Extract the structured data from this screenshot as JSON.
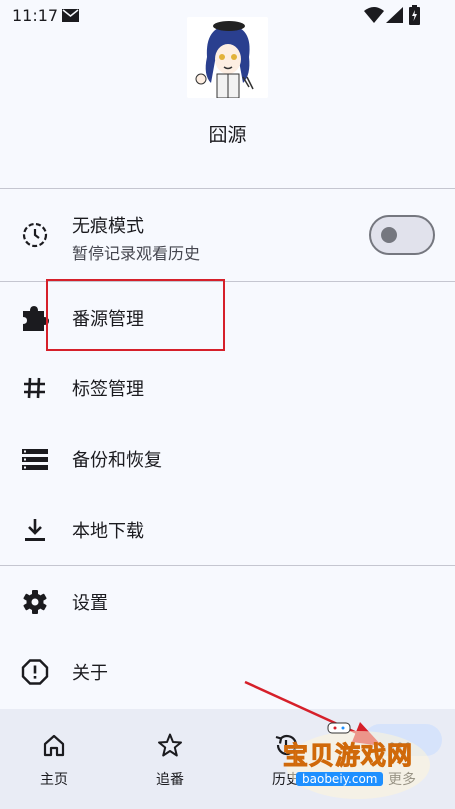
{
  "status_bar": {
    "time": "11:17"
  },
  "header": {
    "title": "囧源"
  },
  "incognito": {
    "title": "无痕模式",
    "subtitle": "暂停记录观看历史",
    "enabled": false
  },
  "menu": {
    "source_manage": "番源管理",
    "tag_manage": "标签管理",
    "backup_restore": "备份和恢复",
    "local_download": "本地下载",
    "settings": "设置",
    "about": "关于"
  },
  "bottom_nav": {
    "items": [
      {
        "label": "主页",
        "icon": "home-icon"
      },
      {
        "label": "追番",
        "icon": "star-icon"
      },
      {
        "label": "历史",
        "icon": "history-icon"
      },
      {
        "label": "更多",
        "icon": "more-icon",
        "selected": true
      }
    ]
  },
  "watermark": {
    "text": "宝贝游戏网",
    "url": "baobeiy.com"
  },
  "colors": {
    "accent": "#d6e3fb",
    "highlight": "#d6202a",
    "background": "#f7f9fe"
  }
}
